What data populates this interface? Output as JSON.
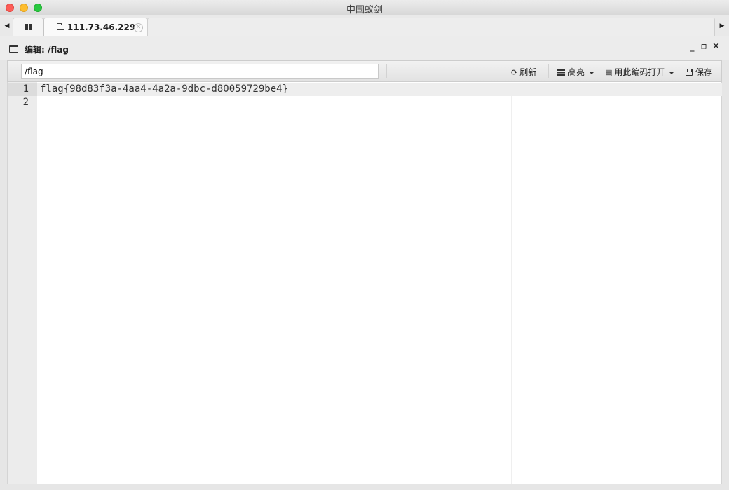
{
  "window": {
    "title": "中国蚁剑"
  },
  "tabs": [
    {
      "icon": "grid-icon",
      "label": ""
    },
    {
      "icon": "folder-icon",
      "label": "111.73.46.229"
    }
  ],
  "panel": {
    "title": "编辑: /flag"
  },
  "toolbar": {
    "path_value": "/flag",
    "refresh_label": "刷新",
    "highlight_label": "高亮",
    "encoding_label": "用此编码打开",
    "save_label": "保存"
  },
  "editor": {
    "lines": [
      {
        "number": "1",
        "text": "flag{98d83f3a-4aa4-4a2a-9dbc-d80059729be4}"
      },
      {
        "number": "2",
        "text": ""
      }
    ]
  }
}
